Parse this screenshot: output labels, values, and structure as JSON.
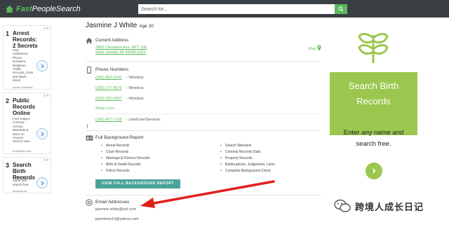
{
  "header": {
    "logo_part1": "Fast",
    "logo_part2": "PeopleSearch",
    "search_placeholder": "Search for..."
  },
  "left_ads": [
    {
      "num": "1",
      "title": "Arrest Records: 2 Secrets",
      "body": "Find Addresses, Phone Numbers, Relatives, Traffic Records, DUIs and Much More!",
      "source": "Arrest Criminals"
    },
    {
      "num": "2",
      "title": "Public Records Online",
      "body": "Find Today's Criminal Arrests, Warrants & More on Anyone. Search Now",
      "source": "truthfinder.com"
    },
    {
      "num": "3",
      "title": "Search Birth Records",
      "body": "Enter any name and search free",
      "source": "ancestry.ca"
    }
  ],
  "profile": {
    "name": "Jasmine J White",
    "age": "Age 30",
    "current_address": {
      "title": "Current Address",
      "line1": "2860 Cleveland Ave, APT 10E",
      "line2": "Saint Joseph, MI 49085-2251",
      "map_label": "Map"
    },
    "phones": {
      "title": "Phone Numbers",
      "items": [
        {
          "number": "(269) 863-5342",
          "type": "- Wireless"
        },
        {
          "number": "(269) 277-8575",
          "type": "- Wireless"
        },
        {
          "number": "(269) 282-0497",
          "type": "- Wireless"
        }
      ],
      "show_less": "Show Less -",
      "landline": {
        "number": "(269) 407-7105",
        "type": "- LandLine/Services"
      }
    },
    "background": {
      "title": "Full Background Report",
      "col1": [
        "Arrest Records",
        "Court Records",
        "Marriage & Divorce Records",
        "Birth & Death Records",
        "Police Records"
      ],
      "col2": [
        "Search Warrants",
        "Criminal Records Data",
        "Property Records",
        "Bankruptcies, Judgments, Liens",
        "Complete Background Check"
      ],
      "button": "VIEW FULL BACKGROUND REPORT"
    },
    "emails": {
      "title": "Email Addresses",
      "items": [
        "jasmine.white@aol.com",
        "jasminew10@yahoo.com"
      ]
    }
  },
  "right_ad": {
    "heading1": "Search Birth",
    "heading2": "Records",
    "text1": "Enter any name and",
    "text2": "search free."
  },
  "watermark": "跨境人成长日记",
  "colors": {
    "header_bg": "#3a3f44",
    "brand_green": "#5cb85c",
    "button_teal": "#4aa39b",
    "ad_green": "#9cc74e",
    "arrow_red": "#e0201b"
  }
}
